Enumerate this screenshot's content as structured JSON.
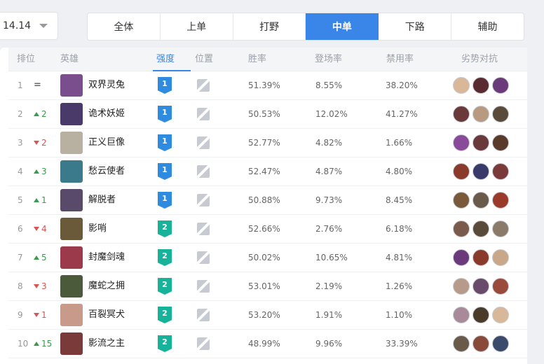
{
  "version": {
    "value": "14.14"
  },
  "lanes": [
    {
      "label": "全体",
      "active": false
    },
    {
      "label": "上单",
      "active": false
    },
    {
      "label": "打野",
      "active": false
    },
    {
      "label": "中单",
      "active": true
    },
    {
      "label": "下路",
      "active": false
    },
    {
      "label": "辅助",
      "active": false
    }
  ],
  "columns": {
    "rank": "排位",
    "hero": "英雄",
    "tier": "强度",
    "position": "位置",
    "winrate": "胜率",
    "pickrate": "登场率",
    "banrate": "禁用率",
    "counters": "劣势对抗"
  },
  "rows": [
    {
      "rank": "1",
      "change": "=",
      "dir": "same",
      "name": "双界灵兔",
      "tier": "1",
      "win": "51.39%",
      "pick": "8.55%",
      "ban": "38.20%",
      "portrait": "#7a4d8c",
      "counters": [
        "#d8b898",
        "#5a2a32",
        "#6a3a7a"
      ]
    },
    {
      "rank": "2",
      "change": "2",
      "dir": "up",
      "name": "诡术妖姬",
      "tier": "1",
      "win": "50.53%",
      "pick": "12.02%",
      "ban": "41.27%",
      "portrait": "#4a3a6a",
      "counters": [
        "#6a3a3a",
        "#b89a80",
        "#5a4a3a"
      ]
    },
    {
      "rank": "3",
      "change": "2",
      "dir": "down",
      "name": "正义巨像",
      "tier": "1",
      "win": "52.77%",
      "pick": "4.82%",
      "ban": "1.66%",
      "portrait": "#b8b0a0",
      "counters": [
        "#8a4a9a",
        "#6a3a3a",
        "#5a3a2a"
      ]
    },
    {
      "rank": "4",
      "change": "3",
      "dir": "up",
      "name": "愁云使者",
      "tier": "1",
      "win": "52.47%",
      "pick": "4.87%",
      "ban": "4.80%",
      "portrait": "#3a7a8a",
      "counters": [
        "#8a3a2a",
        "#3a3a6a",
        "#7a3a3a"
      ]
    },
    {
      "rank": "5",
      "change": "1",
      "dir": "up",
      "name": "解脱者",
      "tier": "1",
      "win": "50.88%",
      "pick": "9.73%",
      "ban": "8.45%",
      "portrait": "#5a4a6a",
      "counters": [
        "#7a5a3a",
        "#6a5a4a",
        "#9a3a2a"
      ]
    },
    {
      "rank": "6",
      "change": "4",
      "dir": "down",
      "name": "影哨",
      "tier": "2",
      "win": "52.66%",
      "pick": "2.76%",
      "ban": "6.18%",
      "portrait": "#6a5a3a",
      "counters": [
        "#7a5a4a",
        "#5a4a3a",
        "#8a7a6a"
      ]
    },
    {
      "rank": "7",
      "change": "5",
      "dir": "up",
      "name": "封魔剑魂",
      "tier": "2",
      "win": "50.02%",
      "pick": "10.65%",
      "ban": "4.81%",
      "portrait": "#9a3a4a",
      "counters": [
        "#6a3a7a",
        "#8a3a2a",
        "#c8a888"
      ]
    },
    {
      "rank": "8",
      "change": "3",
      "dir": "down",
      "name": "魔蛇之拥",
      "tier": "2",
      "win": "53.01%",
      "pick": "2.19%",
      "ban": "1.26%",
      "portrait": "#4a5a3a",
      "counters": [
        "#b89a8a",
        "#6a4a6a",
        "#9a4a3a"
      ]
    },
    {
      "rank": "9",
      "change": "1",
      "dir": "down",
      "name": "百裂冥犬",
      "tier": "2",
      "win": "53.20%",
      "pick": "1.91%",
      "ban": "1.10%",
      "portrait": "#c89a8a",
      "counters": [
        "#a88a9a",
        "#4a3a2a",
        "#d8b898"
      ]
    },
    {
      "rank": "10",
      "change": "15",
      "dir": "up",
      "name": "影流之主",
      "tier": "2",
      "win": "48.99%",
      "pick": "9.96%",
      "ban": "33.39%",
      "portrait": "#7a3a3a",
      "counters": [
        "#6a5a4a",
        "#8a4a3a",
        "#3a4a6a"
      ]
    }
  ]
}
